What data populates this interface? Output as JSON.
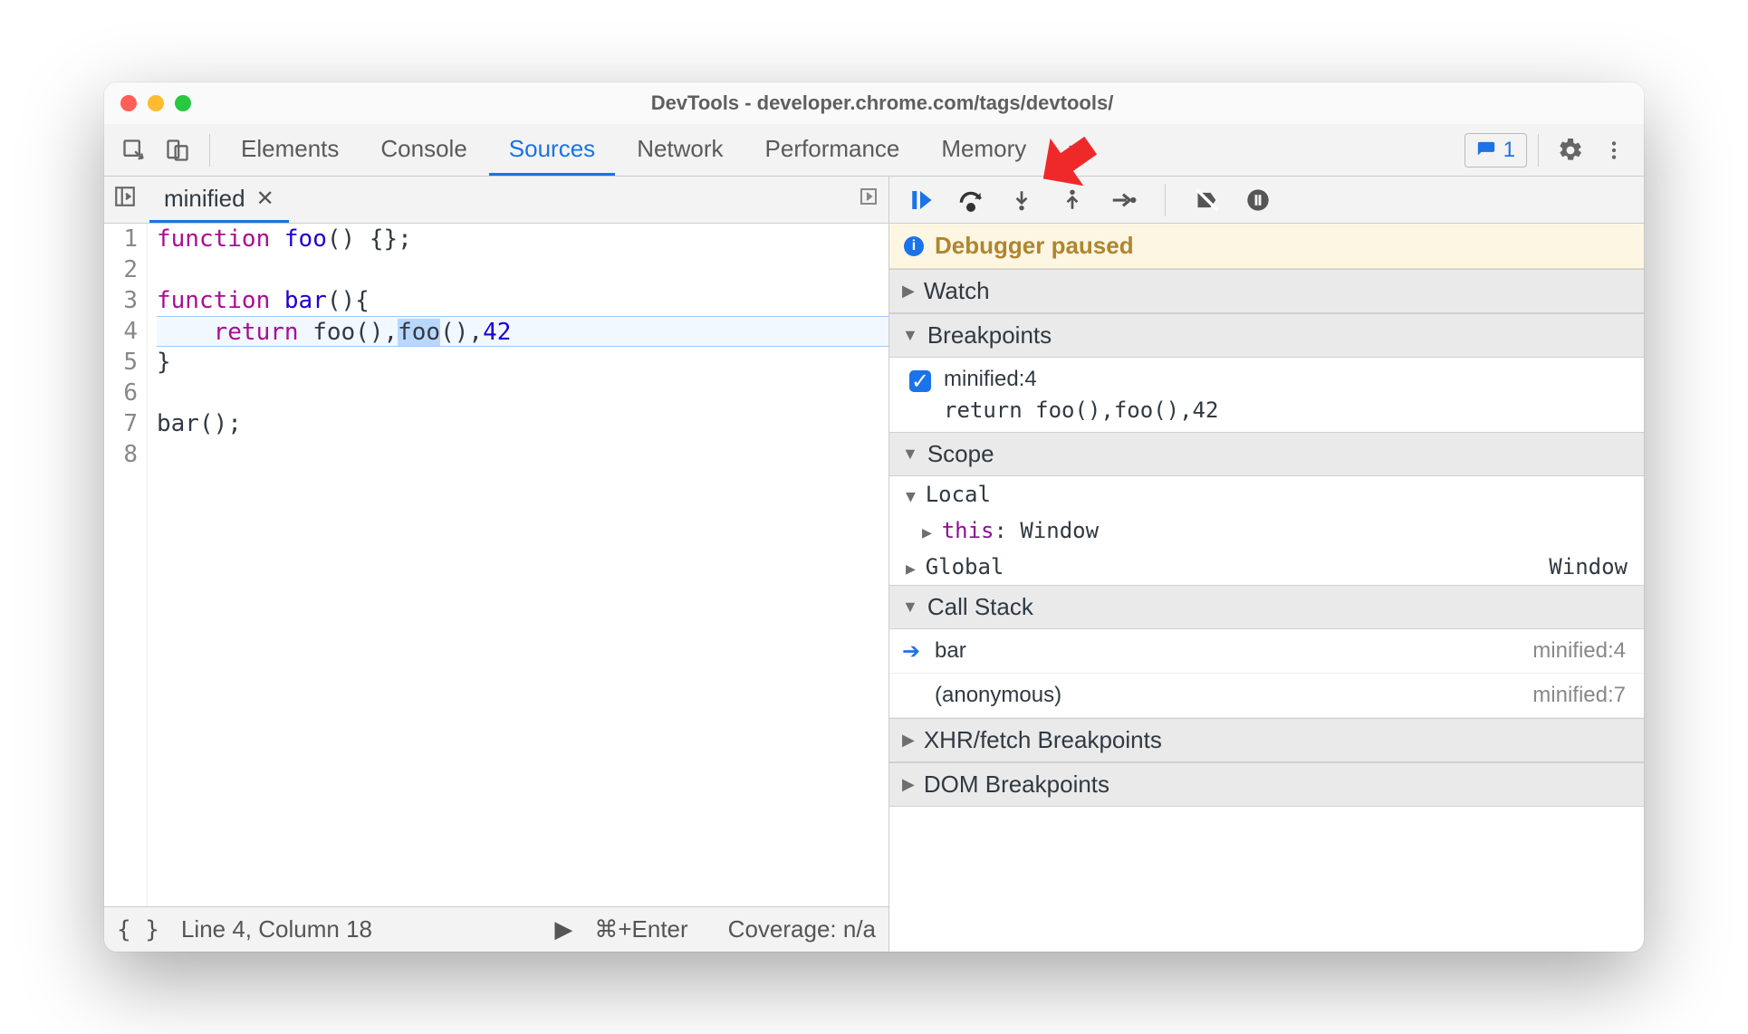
{
  "window_title": "DevTools - developer.chrome.com/tags/devtools/",
  "tabs": [
    "Elements",
    "Console",
    "Sources",
    "Network",
    "Performance",
    "Memory"
  ],
  "active_tab": "Sources",
  "issues_count": "1",
  "file_tab": {
    "name": "minified"
  },
  "code": {
    "lines": [
      "1",
      "2",
      "3",
      "4",
      "5",
      "6",
      "7",
      "8"
    ]
  },
  "code_text": {
    "l1_kw": "function",
    "l1_fn": "foo",
    "l1_rest": "() {};",
    "l3_kw": "function",
    "l3_fn": "bar",
    "l3_rest": "(){",
    "l4_kw": "return",
    "l4_a": " foo(),",
    "l4_sel": "foo",
    "l4_b": "(),",
    "l4_num": "42",
    "l5": "}",
    "l7": "bar();"
  },
  "status": {
    "line_col": "Line 4, Column 18",
    "run_hint": "⌘+Enter",
    "coverage": "Coverage: n/a"
  },
  "debug_notice": "Debugger paused",
  "sections": {
    "watch": "Watch",
    "breakpoints": "Breakpoints",
    "scope": "Scope",
    "callstack": "Call Stack",
    "xhr": "XHR/fetch Breakpoints",
    "dom": "DOM Breakpoints"
  },
  "breakpoint": {
    "label": "minified:4",
    "code": "return foo(),foo(),42"
  },
  "scope": {
    "local": "Local",
    "this_label": "this",
    "this_value": ": Window",
    "global": "Global",
    "global_value": "Window"
  },
  "callstack": [
    {
      "name": "bar",
      "loc": "minified:4"
    },
    {
      "name": "(anonymous)",
      "loc": "minified:7"
    }
  ]
}
